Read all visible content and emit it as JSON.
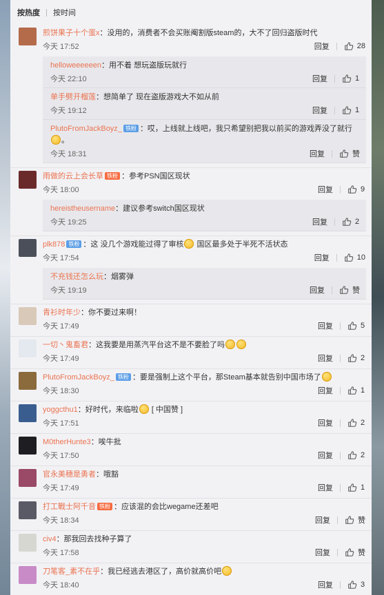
{
  "sort": {
    "hot": "按热度",
    "time": "按时间"
  },
  "labels": {
    "reply": "回复"
  },
  "colors": {
    "name": "#eb7350",
    "panel": "#f2f2f5",
    "reply_bg": "#e8e8ec",
    "badge_blue": "#5c9ee6",
    "badge_vip": "#f76c40"
  },
  "comments": [
    {
      "name": "煎饼果子十个蛋x",
      "text": "：没用的，消费者不会买账阉割版steam的，大不了回归盗版时代",
      "time": "今天 17:52",
      "likes": "28",
      "avatar": "#b46b4a",
      "replies": [
        {
          "name": "helloweeeeeen",
          "text": "：用不着 想玩盗版玩就行",
          "time": "今天 22:10",
          "likes": "1"
        },
        {
          "name": "单手劈开榴莲",
          "text": "：想简单了 现在盗版游戏大不如从前",
          "time": "今天 19:12",
          "likes": "1"
        },
        {
          "name": "PlutoFromJackBoyz_",
          "badge": "铁粉",
          "text": "：哎，上线就上线吧，我只希望别把我以前买的游戏弄没了就行",
          "text2": "。",
          "time": "今天 18:31",
          "likes": "赞"
        }
      ]
    },
    {
      "name": "雨做的云上会长草",
      "vip": "铁粉",
      "text": "：参考PSN国区现状",
      "time": "今天 18:00",
      "likes": "9",
      "avatar": "#6b2a2a",
      "replies": [
        {
          "name": "hereistheusername",
          "text": "：建议参考switch国区现状",
          "time": "今天 19:25",
          "likes": "2"
        }
      ]
    },
    {
      "name": "plk878",
      "badge": "铁粉",
      "text": "：这 没几个游戏能过得了审核",
      "text2": " 国区最多处于半死不活状态",
      "time": "今天 17:54",
      "likes": "10",
      "avatar": "#4a4f59",
      "replies": [
        {
          "name": "不充钱还怎么玩",
          "text": "：烟雾弹",
          "time": "今天 19:19",
          "likes": "赞"
        }
      ]
    },
    {
      "name": "青衫时年少",
      "text": "：你不要过来啊！",
      "time": "今天 17:49",
      "likes": "5",
      "avatar": "#d9c9b8"
    },
    {
      "name": "一切丶鬼畜君",
      "text": "：这我要是用蒸汽平台这不是不要脸了吗",
      "time": "今天 17:49",
      "likes": "2",
      "avatar": "#e4e8ef",
      "emojis": 2
    },
    {
      "name": "PlutoFromJackBoyz_",
      "badge": "铁粉",
      "text": "：要是强制上这个平台，那Steam基本就告别中国市场了",
      "time": "今天 18:30",
      "likes": "1",
      "avatar": "#8b6a3c",
      "emojis": 1
    },
    {
      "name": "yoggcthu1",
      "text": "：好时代，来临啦",
      "text2": " [ 中国赞 ]",
      "time": "今天 17:51",
      "likes": "2",
      "avatar": "#3a5d8f"
    },
    {
      "name": "M0therHunte3",
      "text": "：唉牛批",
      "time": "今天 17:50",
      "likes": "2",
      "avatar": "#1e1e22"
    },
    {
      "name": "官永美穗是勇者",
      "text": "：哦豁",
      "time": "今天 17:49",
      "likes": "1",
      "avatar": "#9a4a66"
    },
    {
      "name": "打工戰士阿千音",
      "vip": "铁粉",
      "text": "：应该混的会比wegame还差吧",
      "time": "今天 18:34",
      "likes": "赞",
      "avatar": "#5a5a66"
    },
    {
      "name": "civ4",
      "text": "：那我回去找种子算了",
      "time": "今天 17:58",
      "likes": "赞",
      "avatar": "#d7d7d2"
    },
    {
      "name": "刀笔客_素不在乎",
      "text": "：我已经逃去港区了，高价就高价吧",
      "time": "今天 18:40",
      "likes": "3",
      "avatar": "#c98bc8",
      "emojis": 1
    }
  ]
}
